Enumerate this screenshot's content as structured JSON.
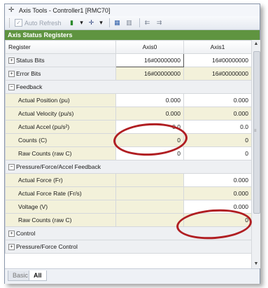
{
  "window": {
    "title": "Axis Tools - Controller1 [RMC70]"
  },
  "toolbar": {
    "auto_refresh_label": "Auto Refresh",
    "auto_refresh_checked": true
  },
  "panel": {
    "title": "Axis Status Registers"
  },
  "table": {
    "columns": [
      "Register",
      "Axis0",
      "Axis1"
    ],
    "rows": [
      {
        "label": "Status Bits",
        "v0": "16#00000000",
        "v1": "16#00000000"
      },
      {
        "label": "Error Bits",
        "v0": "16#00000000",
        "v1": "16#00000000"
      },
      {
        "label": "Feedback"
      },
      {
        "label": "Actual Position (pu)",
        "v0": "0.000",
        "v1": "0.000"
      },
      {
        "label": "Actual Velocity (pu/s)",
        "v0": "0.000",
        "v1": "0.000"
      },
      {
        "label": "Actual Accel (pu/s²)",
        "v0": "0.0",
        "v1": "0.0"
      },
      {
        "label": "Counts (C)",
        "v0": "0",
        "v1": "0"
      },
      {
        "label": "Raw Counts (raw C)",
        "v0": "0",
        "v1": "0"
      },
      {
        "label": "Pressure/Force/Accel Feedback"
      },
      {
        "label": "Actual Force (Fr)",
        "v0": "",
        "v1": "0.000"
      },
      {
        "label": "Actual Force Rate (Fr/s)",
        "v0": "",
        "v1": "0.000"
      },
      {
        "label": "Voltage (V)",
        "v0": "",
        "v1": "0.000"
      },
      {
        "label": "Raw Counts (raw C)",
        "v0": "",
        "v1": "0"
      },
      {
        "label": "Control"
      },
      {
        "label": "Pressure/Force Control"
      }
    ],
    "expand_plus": "⊞",
    "expand_minus": "⊟"
  },
  "tabs": [
    "Basic",
    "All"
  ],
  "colors": {
    "panel_header": "#5f9440",
    "highlight_oval": "#b01e22"
  }
}
